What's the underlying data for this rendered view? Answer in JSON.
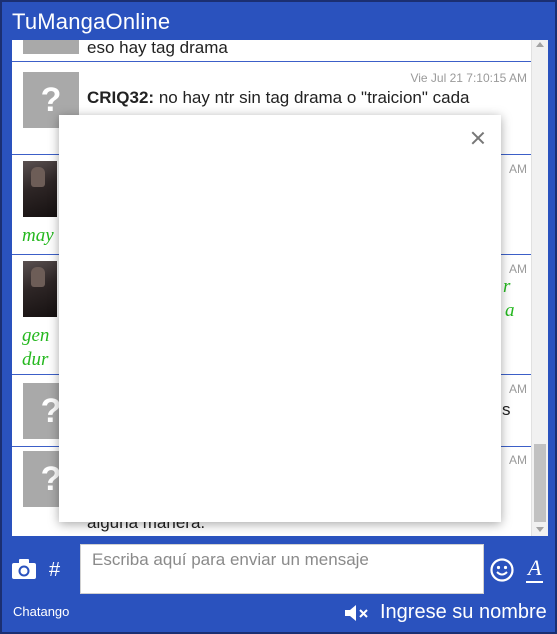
{
  "app": {
    "title": "TuMangaOnline"
  },
  "messages": {
    "top_partial": {
      "text": "eso hay tag drama"
    },
    "m1": {
      "time": "Vie Jul 21 7:10:15 AM",
      "author": "CRIQ32:",
      "text": "no hay ntr sin tag drama o \"traicion\" cada"
    },
    "m2": {
      "time": "AM",
      "name_partial": "may"
    },
    "m3": {
      "time": "AM",
      "name_partial_1": "gen",
      "name_partial_2": "dur",
      "right_1": "r",
      "right_2": "a"
    },
    "m4": {
      "time": "AM",
      "right": "s"
    },
    "m5": {
      "time": "AM",
      "bottom_partial": "alguna manera."
    }
  },
  "composer": {
    "placeholder": "Escriba aquí para enviar un mensaje",
    "hash_label": "#",
    "font_label": "A"
  },
  "footer": {
    "brand": "Chatango",
    "login_label": "Ingrese su nombre"
  },
  "icons": {
    "camera": "camera-icon",
    "smiley": "smiley-icon",
    "speaker_muted": "speaker-muted-icon",
    "close": "close-icon"
  },
  "colors": {
    "frame_blue": "#2a52be",
    "username_green": "#25b81f",
    "divider_blue": "#3c5fc8"
  }
}
